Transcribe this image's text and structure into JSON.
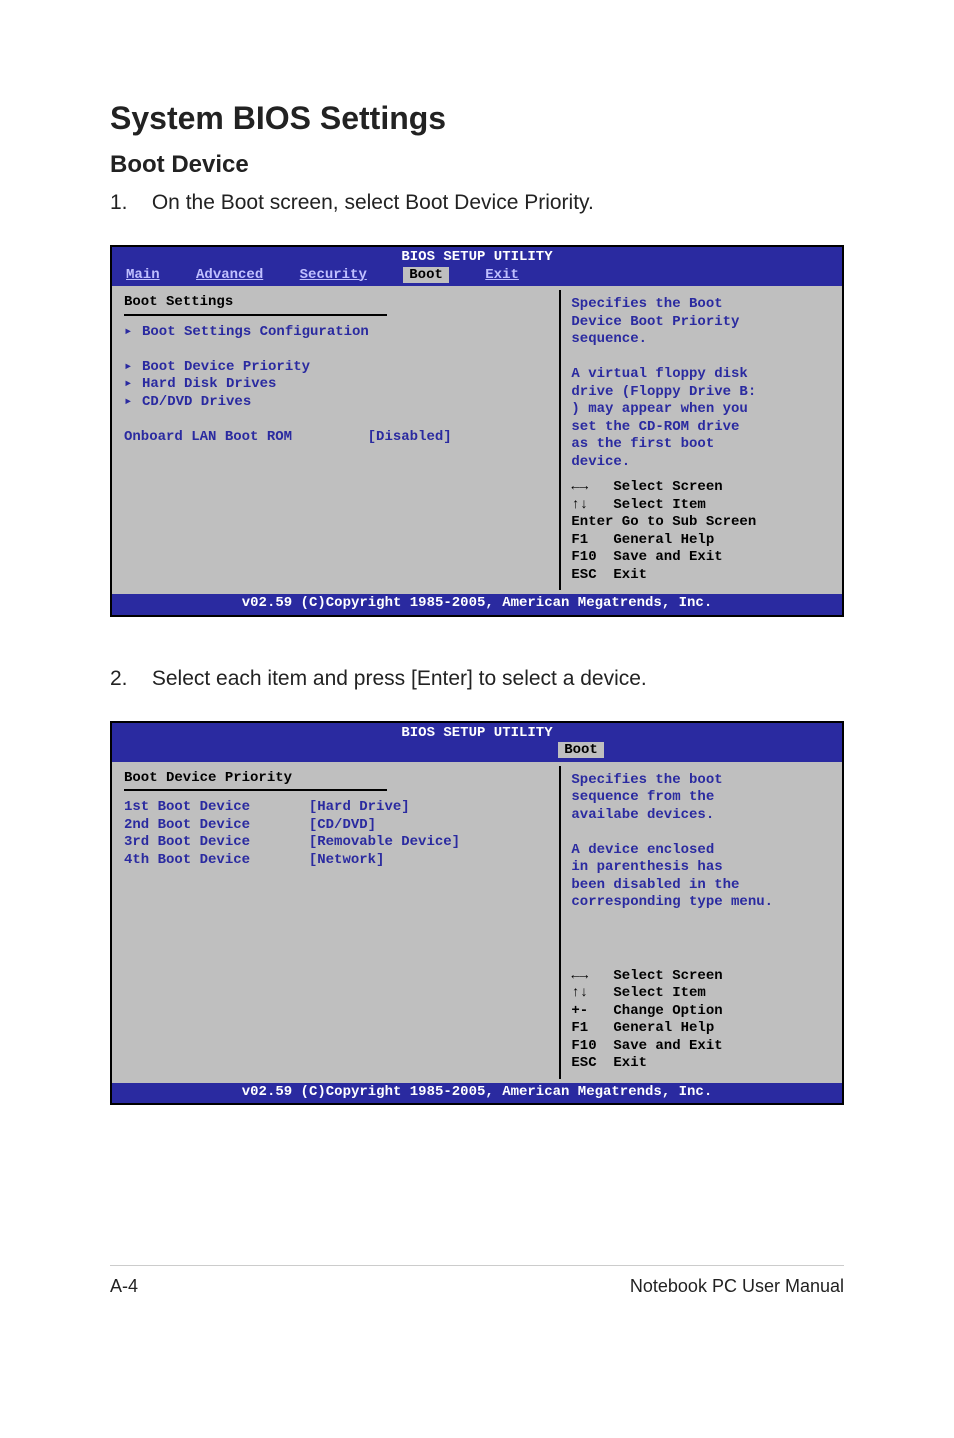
{
  "headings": {
    "title": "System BIOS Settings",
    "subtitle": "Boot Device"
  },
  "steps": {
    "one_num": "1.",
    "one_text": "On the Boot screen, select Boot Device Priority.",
    "two_num": "2.",
    "two_text": "Select each item and press [Enter] to select a device."
  },
  "bios_common": {
    "topbar": "BIOS SETUP UTILITY",
    "bottombar": "v02.59 (C)Copyright 1985-2005, American Megatrends, Inc."
  },
  "bios1": {
    "tabs": {
      "main": "Main",
      "advanced": "Advanced",
      "security": "Security",
      "boot": "Boot",
      "exit": "Exit"
    },
    "panel_title": "Boot Settings",
    "items": {
      "cfg": "Boot Settings Configuration",
      "prio": "Boot Device Priority",
      "hdd": "Hard Disk Drives",
      "cddvd": "CD/DVD Drives"
    },
    "option": {
      "label": "Onboard LAN Boot ROM",
      "value": "[Disabled]"
    },
    "help_top": "Specifies the Boot\nDevice Boot Priority\nsequence.\n\nA virtual floppy disk\ndrive (Floppy Drive B:\n) may appear when you\nset the CD-ROM drive\nas the first boot\ndevice.",
    "keys": {
      "k1": "←→   Select Screen",
      "k2": "↑↓   Select Item",
      "k3": "Enter Go to Sub Screen",
      "k4": "F1   General Help",
      "k5": "F10  Save and Exit",
      "k6": "ESC  Exit"
    }
  },
  "bios2": {
    "tabs": {
      "boot": "Boot"
    },
    "panel_title": "Boot Device Priority",
    "rows": {
      "r1l": "1st Boot Device",
      "r1v": "[Hard Drive]",
      "r2l": "2nd Boot Device",
      "r2v": "[CD/DVD]",
      "r3l": "3rd Boot Device",
      "r3v": "[Removable Device]",
      "r4l": "4th Boot Device",
      "r4v": "[Network]"
    },
    "help_top": "Specifies the boot\nsequence from the\navailabe devices.\n\nA device enclosed\nin parenthesis has\nbeen disabled in the\ncorresponding type menu.",
    "keys": {
      "k1": "←→   Select Screen",
      "k2": "↑↓   Select Item",
      "k3": "+-   Change Option",
      "k4": "F1   General Help",
      "k5": "F10  Save and Exit",
      "k6": "ESC  Exit"
    }
  },
  "footer": {
    "left": "A-4",
    "right": "Notebook PC User Manual"
  }
}
